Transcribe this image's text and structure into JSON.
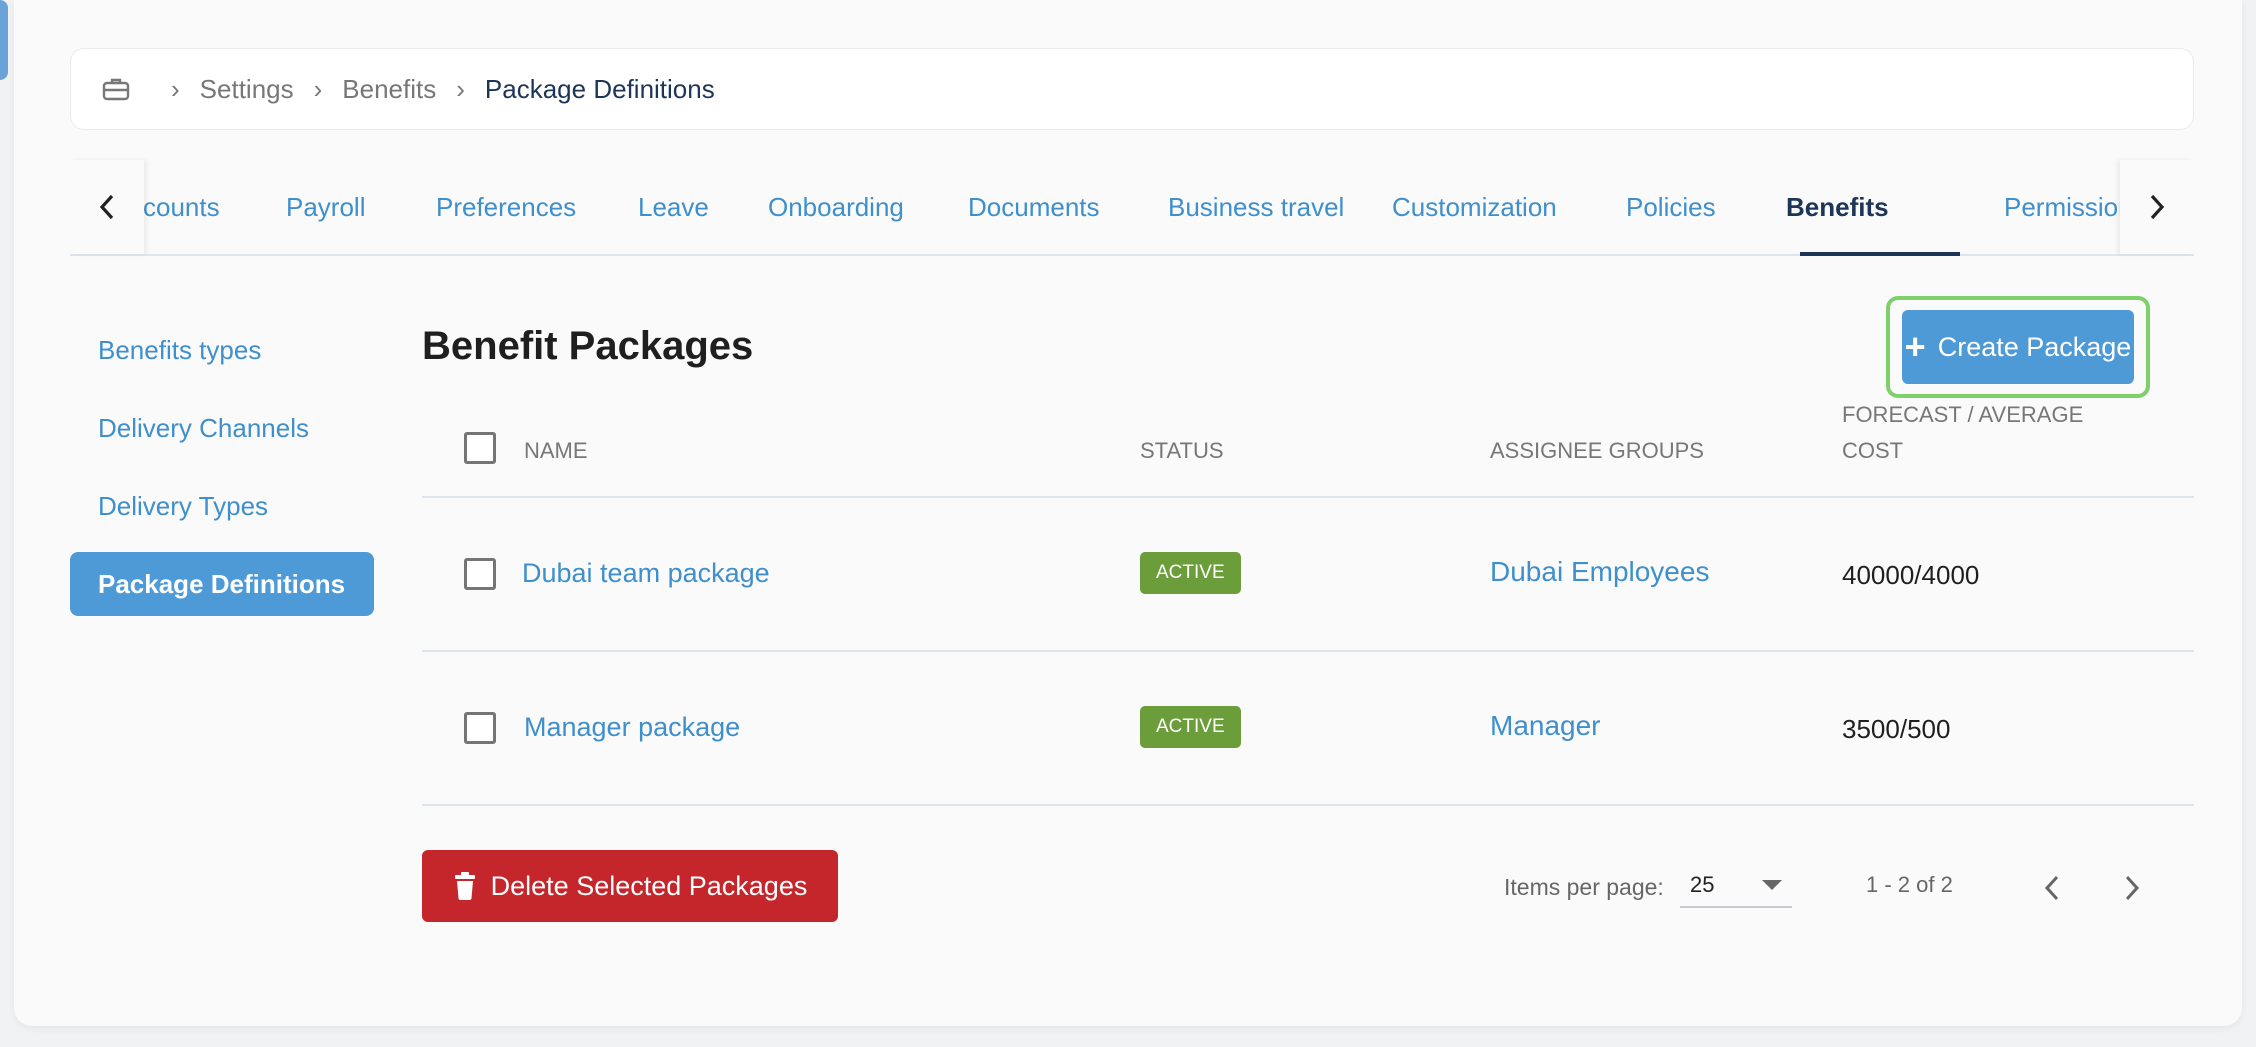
{
  "breadcrumb": {
    "icon": "briefcase-icon",
    "items": [
      "Settings",
      "Benefits"
    ],
    "current": "Package Definitions"
  },
  "tabs": {
    "items": [
      "ccounts",
      "Payroll",
      "Preferences",
      "Leave",
      "Onboarding",
      "Documents",
      "Business travel",
      "Customization",
      "Policies",
      "Benefits",
      "Permissions"
    ],
    "active": "Benefits"
  },
  "sidenav": {
    "items": [
      "Benefits types",
      "Delivery Channels",
      "Delivery Types",
      "Package Definitions"
    ],
    "active": "Package Definitions"
  },
  "main": {
    "title": "Benefit Packages",
    "create_label": "Create Package"
  },
  "table": {
    "headers": {
      "name": "NAME",
      "status": "STATUS",
      "assignee": "ASSIGNEE GROUPS",
      "cost_line1": "FORECAST / AVERAGE",
      "cost_line2": "COST"
    },
    "rows": [
      {
        "name": "Dubai team package",
        "status": "ACTIVE",
        "group": "Dubai Employees",
        "cost": "40000/4000"
      },
      {
        "name": "Manager package",
        "status": "ACTIVE",
        "group": "Manager",
        "cost": "3500/500"
      }
    ]
  },
  "footer": {
    "delete_label": "Delete Selected Packages",
    "items_per_page_label": "Items per page:",
    "items_per_page_value": "25",
    "range": "1 - 2 of 2"
  },
  "colors": {
    "accent": "#4e9ad6",
    "link": "#3f8fcc",
    "navy": "#1d3557",
    "danger": "#c5262b",
    "active_badge": "#6b9e3a",
    "highlight": "#7ed06a"
  }
}
